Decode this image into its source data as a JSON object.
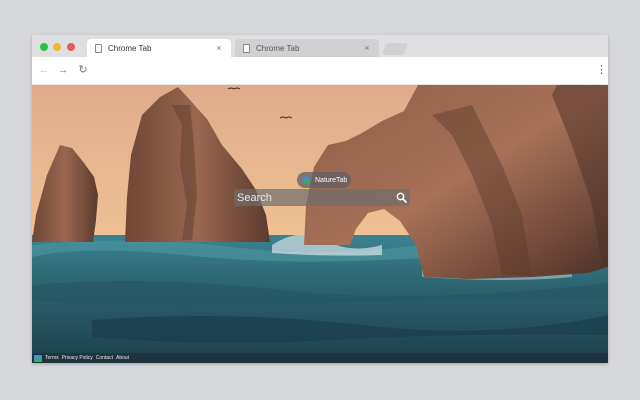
{
  "browser": {
    "tabs": [
      {
        "title": "Chrome Tab",
        "active": true
      },
      {
        "title": "Chrome Tab",
        "active": false
      }
    ],
    "close_glyph": "×",
    "nav": {
      "back": "←",
      "forward": "→",
      "reload": "↻",
      "menu": "⋮"
    },
    "address": ""
  },
  "page": {
    "brand_name": "NatureTab",
    "search_placeholder": "Search",
    "footer_links": [
      "Terms",
      "Privacy Policy",
      "Contact",
      "About"
    ]
  },
  "icons": [
    "document-icon",
    "close-icon",
    "back-arrow-icon",
    "forward-arrow-icon",
    "reload-icon",
    "menu-dots-icon",
    "naturetab-logo-icon",
    "search-icon"
  ],
  "colors": {
    "window_chrome": "#dedfe1",
    "traffic_green": "#2bc43f",
    "traffic_yellow": "#f0b92b",
    "traffic_red": "#e45b52",
    "sky": "#e9b88d",
    "rock": "#8a5a42",
    "sea": "#2f6270"
  }
}
